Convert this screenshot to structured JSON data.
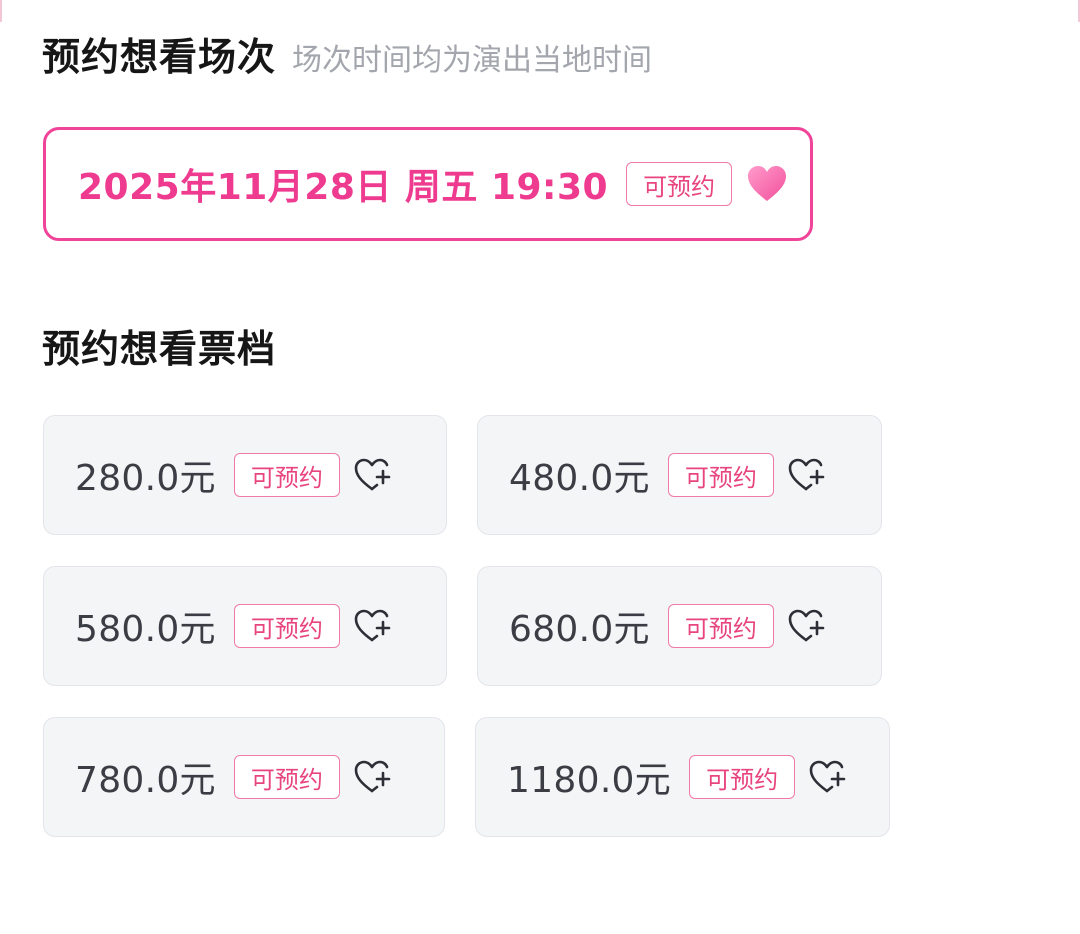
{
  "session_section": {
    "title": "预约想看场次",
    "subtitle": "场次时间均为演出当地时间"
  },
  "session": {
    "label": "2025年11月28日 周五 19:30",
    "status": "可预约",
    "favorite_icon": "heart-filled-icon"
  },
  "tier_section": {
    "title": "预约想看票档"
  },
  "tiers": [
    {
      "price": "280.0元",
      "status": "可预约",
      "icon": "heart-plus-icon"
    },
    {
      "price": "480.0元",
      "status": "可预约",
      "icon": "heart-plus-icon"
    },
    {
      "price": "580.0元",
      "status": "可预约",
      "icon": "heart-plus-icon"
    },
    {
      "price": "680.0元",
      "status": "可预约",
      "icon": "heart-plus-icon"
    },
    {
      "price": "780.0元",
      "status": "可预约",
      "icon": "heart-plus-icon"
    },
    {
      "price": "1180.0元",
      "status": "可预约",
      "icon": "heart-plus-icon"
    }
  ],
  "colors": {
    "accent": "#ee3a8f",
    "badge_border": "#f07aa8",
    "card_bg": "#f4f5f7",
    "subtitle": "#a3a6ad"
  }
}
